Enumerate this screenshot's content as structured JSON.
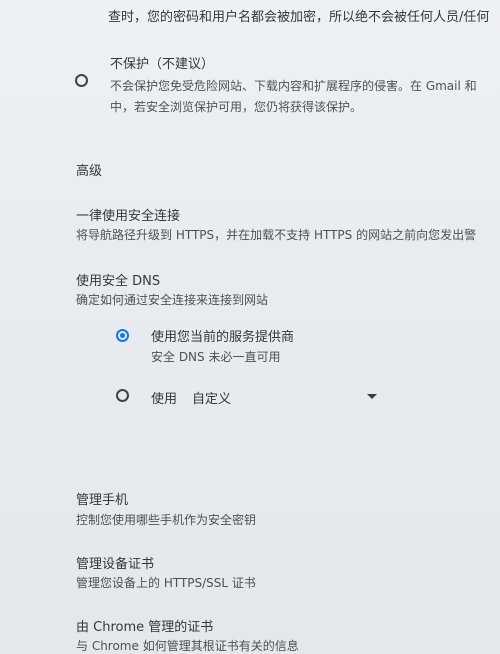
{
  "top_text": "查时，您的密码和用户名都会被加密，所以绝不会被任何人员/任何",
  "no_protection": {
    "title": "不保护（不建议）",
    "desc_line1": "不会保护您免受危险网站、下载内容和扩展程序的侵害。在 Gmail 和",
    "desc_line2": "中，若安全浏览保护可用，您仍将获得该保护。"
  },
  "advanced_heading": "高级",
  "always_secure": {
    "title": "一律使用安全连接",
    "desc": "将导航路径升级到 HTTPS，并在加载不支持 HTTPS 的网站之前向您发出警"
  },
  "secure_dns": {
    "title": "使用安全 DNS",
    "desc": "确定如何通过安全连接来连接到网站",
    "option_current_title": "使用您当前的服务提供商",
    "option_current_desc": "安全 DNS 未必一直可用",
    "option_custom_label": "使用",
    "option_custom_select": "自定义"
  },
  "manage_phones": {
    "title": "管理手机",
    "desc": "控制您使用哪些手机作为安全密钥"
  },
  "manage_certs": {
    "title": "管理设备证书",
    "desc": "管理您设备上的 HTTPS/SSL 证书"
  },
  "chrome_certs": {
    "title": "由 Chrome 管理的证书",
    "desc": "与 Chrome 如何管理其根证书有关的信息"
  }
}
